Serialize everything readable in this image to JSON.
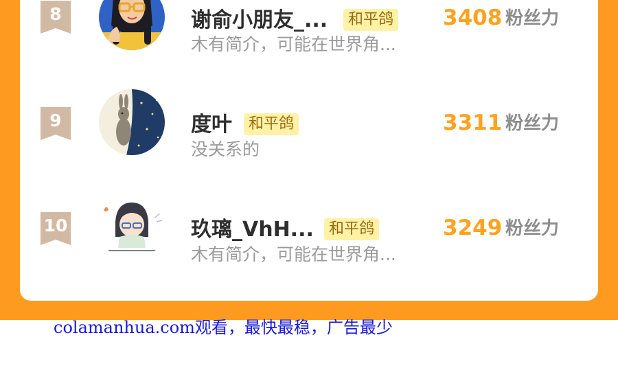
{
  "colors": {
    "frame": "#ff9a20",
    "card": "#ffffff",
    "rank_badge": "#d2b9a4",
    "tag_bg": "#fff2a6",
    "tag_text": "#9a6a12",
    "score": "#ffa21f",
    "watermark": "#1a1ad6"
  },
  "ranking": {
    "rows": [
      {
        "rank": "8",
        "name": "谢俞小朋友_...",
        "tag": "和平鸽",
        "bio": "木有简介，可能在世界角...",
        "score": "3408",
        "score_unit": "粉丝力",
        "avatar_icon": "girl-with-glasses-avatar"
      },
      {
        "rank": "9",
        "name": "度叶",
        "tag": "和平鸽",
        "bio": "没关系的",
        "score": "3311",
        "score_unit": "粉丝力",
        "avatar_icon": "rabbit-night-sky-avatar"
      },
      {
        "rank": "10",
        "name": "玖璃_VhH...",
        "tag": "和平鸽",
        "bio": "木有简介，可能在世界角...",
        "score": "3249",
        "score_unit": "粉丝力",
        "avatar_icon": "chibi-girl-avatar"
      }
    ]
  },
  "watermark": {
    "text": "colamanhua.com观看，最快最稳，广告最少"
  }
}
